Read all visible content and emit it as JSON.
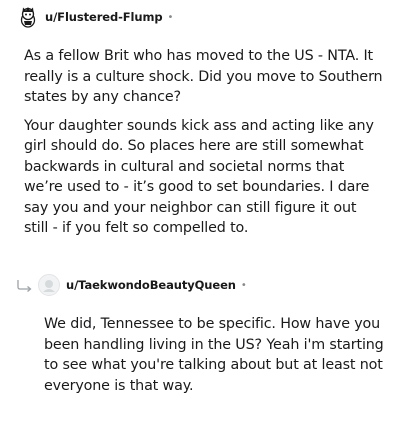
{
  "comments": [
    {
      "username": "u/Flustered-Flump",
      "separator": "•",
      "paragraphs": [
        "As a fellow Brit who has moved to the US - NTA. It really is a culture shock. Did you move to Southern states by any chance?",
        "Your daughter sounds kick ass and acting like any girl should do. So places here are still somewhat backwards in cultural and societal norms that we’re used to - it’s good to set boundaries. I dare say you and your neighbor can still figure it out still - if you felt so compelled to."
      ]
    },
    {
      "username": "u/TaekwondoBeautyQueen",
      "separator": "•",
      "paragraphs": [
        "We did, Tennessee to be specific. How have you been handling living in the US? Yeah i'm starting to see what you're talking about but at least not everyone is that way."
      ]
    }
  ],
  "icons": {
    "avatar1": "snoo-avatar-icon",
    "avatar2": "default-avatar-icon",
    "reply": "reply-arrow-icon"
  }
}
